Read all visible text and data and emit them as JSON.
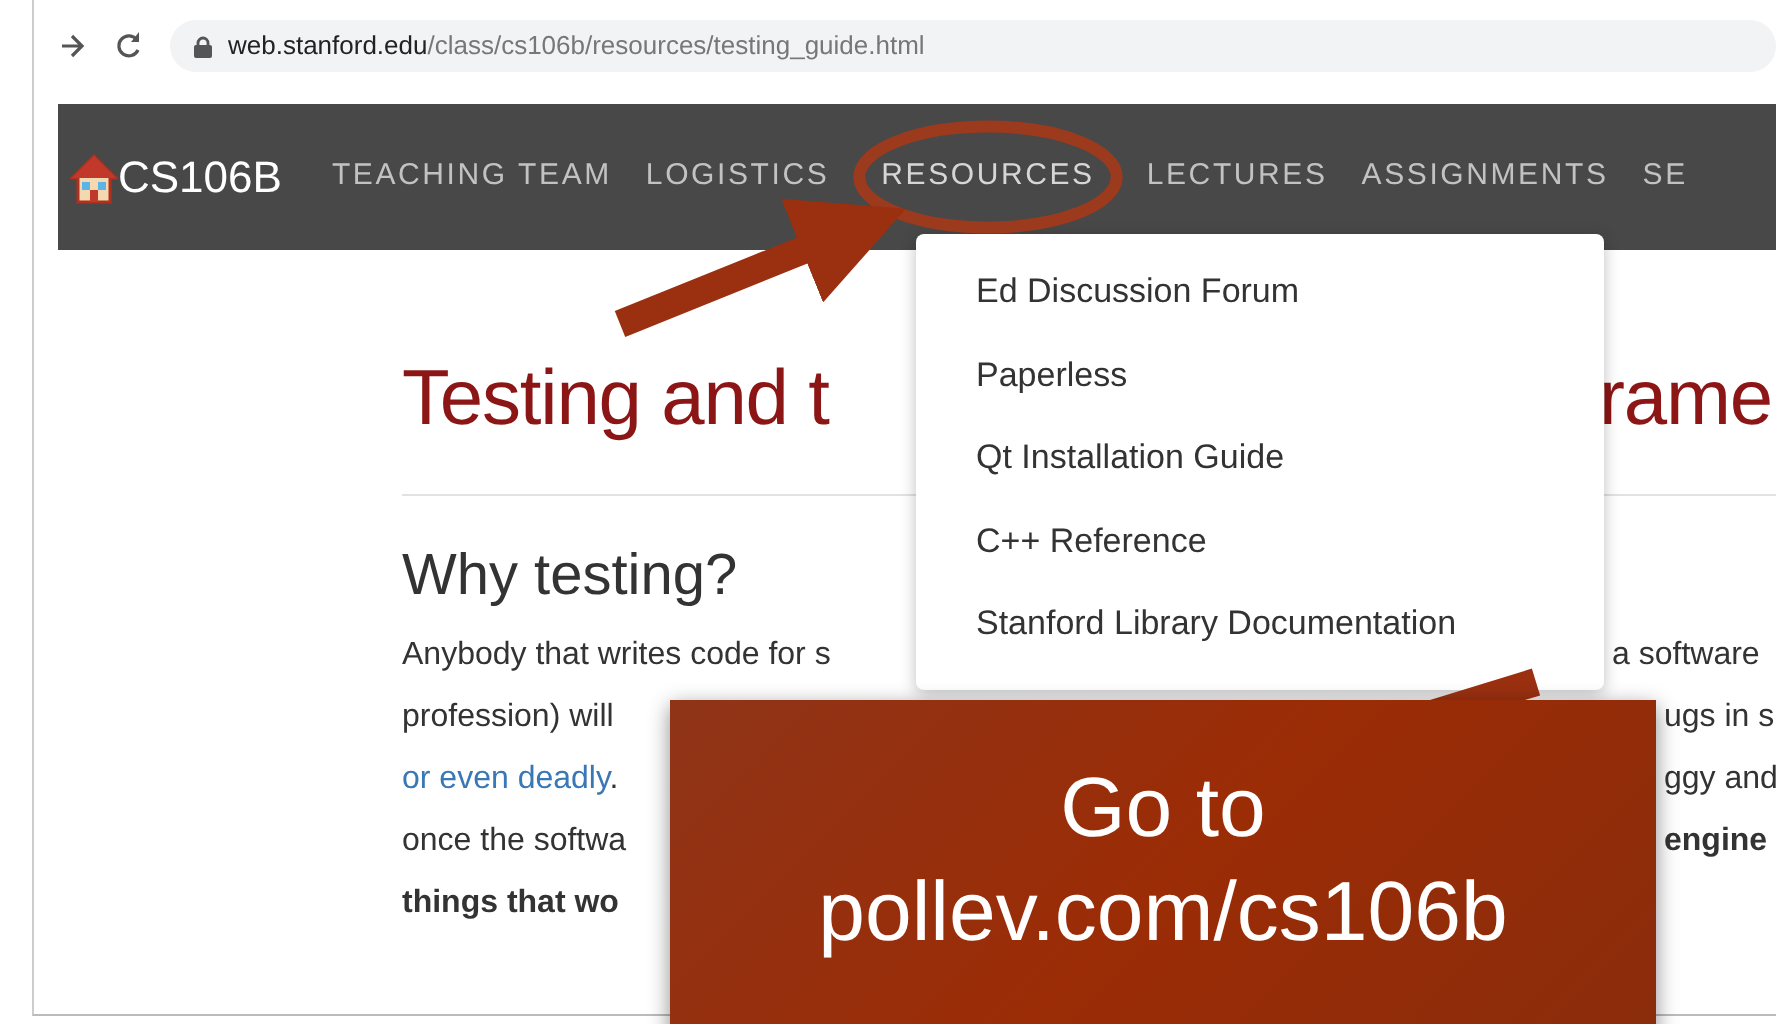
{
  "browser": {
    "url_host": "web.stanford.edu",
    "url_path": "/class/cs106b/resources/testing_guide.html"
  },
  "navbar": {
    "brand": "CS106B",
    "items": [
      {
        "label": "TEACHING TEAM",
        "expanded": false
      },
      {
        "label": "LOGISTICS",
        "expanded": false
      },
      {
        "label": "RESOURCES",
        "expanded": true
      },
      {
        "label": "LECTURES",
        "expanded": false
      },
      {
        "label": "ASSIGNMENTS",
        "expanded": false
      },
      {
        "label": "SE",
        "expanded": false
      }
    ]
  },
  "dropdown": {
    "items": [
      "Ed Discussion Forum",
      "Paperless",
      "Qt Installation Guide",
      "C++ Reference",
      "Stanford Library Documentation"
    ]
  },
  "page": {
    "title_left": "Testing and t",
    "title_right": "rame",
    "heading": "Why testing?",
    "lines": [
      {
        "left": [
          {
            "kind": "text",
            "text": "Anybody that writes code for s"
          }
        ],
        "right": [
          {
            "kind": "text",
            "text": "a software"
          }
        ]
      },
      {
        "left": [
          {
            "kind": "text",
            "text": "profession) will"
          }
        ],
        "right": [
          {
            "kind": "text",
            "text": "ugs in s"
          }
        ]
      },
      {
        "left": [
          {
            "kind": "link",
            "text": "or even deadly"
          },
          {
            "kind": "text",
            "text": "."
          }
        ],
        "right": [
          {
            "kind": "text",
            "text": "ggy and"
          }
        ]
      },
      {
        "left": [
          {
            "kind": "text",
            "text": "once the softwa"
          }
        ],
        "right": [
          {
            "kind": "bold",
            "text": "engine"
          }
        ]
      },
      {
        "left": [
          {
            "kind": "bold",
            "text": "things that wo"
          }
        ]
      }
    ]
  },
  "callout": {
    "lines": [
      "Go to",
      "pollev.com/cs106b"
    ]
  }
}
